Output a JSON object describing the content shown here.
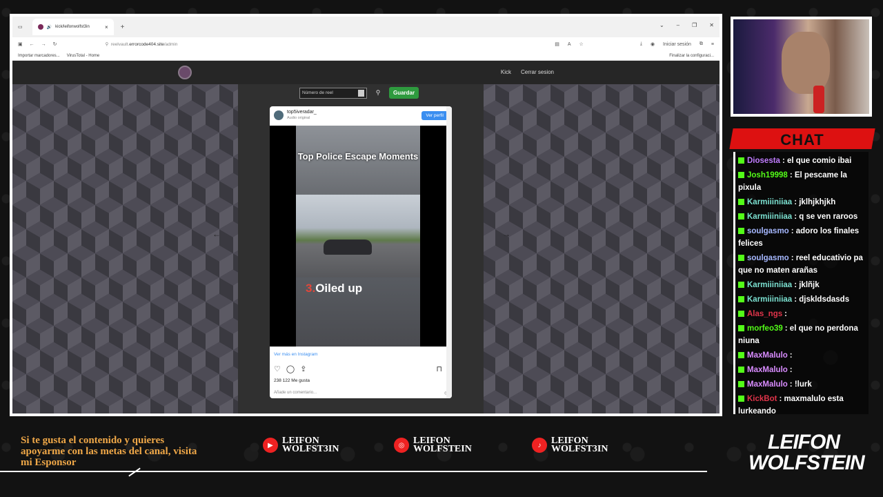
{
  "browser": {
    "tab_title": "kick/leifonwolfst3in",
    "address_prefix": "reelvault.",
    "address_host": "errorcode404.site",
    "address_path": "/admin",
    "signin_label": "Iniciar sesión",
    "bookmark_import": "Importar marcadores...",
    "bookmark_virustotal": "VirusTotal - Home",
    "finish_setup": "Finalizar la configuraci..."
  },
  "site": {
    "nav_links": [
      "Kick",
      "Cerrar sesion"
    ],
    "reel_placeholder": "Número de reel",
    "save_label": "Guardar"
  },
  "instagram": {
    "username": "top5iveradar_",
    "audio": "Audio original",
    "follow_label": "Ver perfil",
    "video_title": "Top Police Escape Moments",
    "video_number": "3.",
    "video_caption": "Oiled up",
    "more_link": "Ver más en Instagram",
    "likes": "238 122 Me gusta",
    "comment_placeholder": "Añade un comentario..."
  },
  "chat": {
    "title": "CHAT",
    "messages": [
      {
        "user": "Diosesta",
        "color": "#c07cff",
        "text": ": el que comio ibai"
      },
      {
        "user": "Josh19998",
        "color": "#53fc18",
        "text": ": El pescame la pixula"
      },
      {
        "user": "Karmiiiniiaa",
        "color": "#7be0d0",
        "text": ": jklhjkhjkh"
      },
      {
        "user": "Karmiiiniiaa",
        "color": "#7be0d0",
        "text": ": q se ven raroos"
      },
      {
        "user": "soulgasmo",
        "color": "#a6b8ff",
        "text": ": adoro los finales felices"
      },
      {
        "user": "soulgasmo",
        "color": "#a6b8ff",
        "text": ": reel educativio pa que no maten arañas"
      },
      {
        "user": "Karmiiiniiaa",
        "color": "#7be0d0",
        "text": ": jklñjk"
      },
      {
        "user": "Karmiiiniiaa",
        "color": "#7be0d0",
        "text": ": djskldsdasds"
      },
      {
        "user": "Alas_ngs",
        "color": "#e0344a",
        "text": ":"
      },
      {
        "user": "morfeo39",
        "color": "#53fc18",
        "text": ": el que no perdona niuna"
      },
      {
        "user": "MaxMalulo",
        "color": "#d98cff",
        "text": ":"
      },
      {
        "user": "MaxMalulo",
        "color": "#d98cff",
        "text": ":"
      },
      {
        "user": "MaxMalulo",
        "color": "#d98cff",
        "text": ": !lurk"
      },
      {
        "user": "KickBot",
        "color": "#e0344a",
        "text": ": maxmalulo esta lurkeando"
      }
    ]
  },
  "footer": {
    "sponsor_text": "Si te gusta el contenido y quieres apoyarme con las metas del canal, visita mi Esponsor",
    "youtube_name": "LEIFON WOLFST3IN",
    "instagram_name": "LEIFON WOLFSTEIN",
    "tiktok_name": "LEIFON WOLFST3IN",
    "brand_line1": "LEIFON",
    "brand_line2": "WOLFSTEIN"
  }
}
